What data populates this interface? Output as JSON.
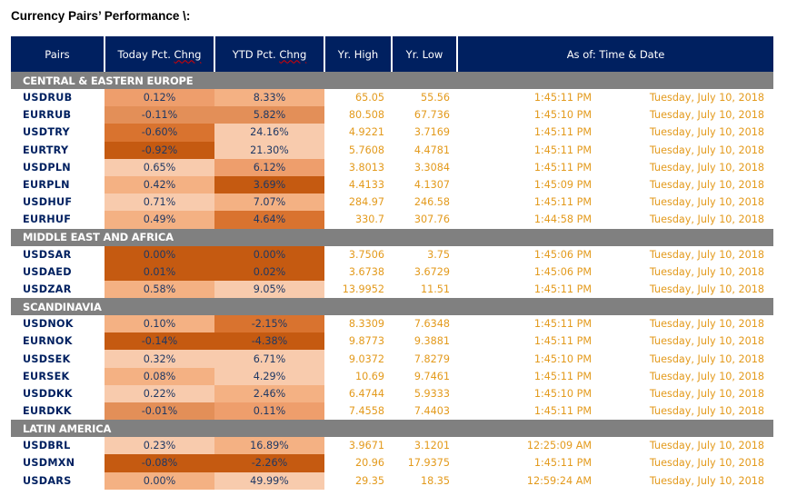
{
  "title": "Currency Pairs’ Performance \\:",
  "header": {
    "pairs": "Pairs",
    "today_pre": "Today Pct. ",
    "today_sq": "Chng",
    "ytd_pre": "YTD Pct. ",
    "ytd_sq": "Chng",
    "high": "Yr. High",
    "low": "Yr. Low",
    "asof": "As of: Time & Date"
  },
  "heat_colors": {
    "1": "#F8CBAD",
    "2": "#F4B183",
    "3": "#EE9E6C",
    "4": "#E38F58",
    "5": "#D9732F",
    "6": "#C55A11"
  },
  "groups": [
    {
      "name": "CENTRAL & EASTERN EUROPE",
      "rows": [
        {
          "pair": "USDRUB",
          "today": "0.12%",
          "today_heat": 3,
          "ytd": "8.33%",
          "ytd_heat": 2,
          "high": "65.05",
          "low": "55.56",
          "time": "1:45:11 PM",
          "date": "Tuesday, July 10, 2018"
        },
        {
          "pair": "EURRUB",
          "today": "-0.11%",
          "today_heat": 4,
          "ytd": "5.82%",
          "ytd_heat": 4,
          "high": "80.508",
          "low": "67.736",
          "time": "1:45:10 PM",
          "date": "Tuesday, July 10, 2018"
        },
        {
          "pair": "USDTRY",
          "today": "-0.60%",
          "today_heat": 5,
          "ytd": "24.16%",
          "ytd_heat": 1,
          "high": "4.9221",
          "low": "3.7169",
          "time": "1:45:11 PM",
          "date": "Tuesday, July 10, 2018"
        },
        {
          "pair": "EURTRY",
          "today": "-0.92%",
          "today_heat": 6,
          "ytd": "21.30%",
          "ytd_heat": 1,
          "high": "5.7608",
          "low": "4.4781",
          "time": "1:45:11 PM",
          "date": "Tuesday, July 10, 2018"
        },
        {
          "pair": "USDPLN",
          "today": "0.65%",
          "today_heat": 1,
          "ytd": "6.12%",
          "ytd_heat": 3,
          "high": "3.8013",
          "low": "3.3084",
          "time": "1:45:11 PM",
          "date": "Tuesday, July 10, 2018"
        },
        {
          "pair": "EURPLN",
          "today": "0.42%",
          "today_heat": 2,
          "ytd": "3.69%",
          "ytd_heat": 6,
          "high": "4.4133",
          "low": "4.1307",
          "time": "1:45:09 PM",
          "date": "Tuesday, July 10, 2018"
        },
        {
          "pair": "USDHUF",
          "today": "0.71%",
          "today_heat": 1,
          "ytd": "7.07%",
          "ytd_heat": 2,
          "high": "284.97",
          "low": "246.58",
          "time": "1:45:11 PM",
          "date": "Tuesday, July 10, 2018"
        },
        {
          "pair": "EURHUF",
          "today": "0.49%",
          "today_heat": 2,
          "ytd": "4.64%",
          "ytd_heat": 5,
          "high": "330.7",
          "low": "307.76",
          "time": "1:44:58 PM",
          "date": "Tuesday, July 10, 2018"
        }
      ]
    },
    {
      "name": "MIDDLE EAST AND AFRICA",
      "rows": [
        {
          "pair": "USDSAR",
          "today": "0.00%",
          "today_heat": 6,
          "ytd": "0.00%",
          "ytd_heat": 6,
          "high": "3.7506",
          "low": "3.75",
          "time": "1:45:06 PM",
          "date": "Tuesday, July 10, 2018"
        },
        {
          "pair": "USDAED",
          "today": "0.01%",
          "today_heat": 6,
          "ytd": "0.02%",
          "ytd_heat": 6,
          "high": "3.6738",
          "low": "3.6729",
          "time": "1:45:06 PM",
          "date": "Tuesday, July 10, 2018"
        },
        {
          "pair": "USDZAR",
          "today": "0.58%",
          "today_heat": 2,
          "ytd": "9.05%",
          "ytd_heat": 1,
          "high": "13.9952",
          "low": "11.51",
          "time": "1:45:11 PM",
          "date": "Tuesday, July 10, 2018"
        }
      ]
    },
    {
      "name": "SCANDINAVIA",
      "rows": [
        {
          "pair": "USDNOK",
          "today": "0.10%",
          "today_heat": 2,
          "ytd": "-2.15%",
          "ytd_heat": 5,
          "high": "8.3309",
          "low": "7.6348",
          "time": "1:45:11 PM",
          "date": "Tuesday, July 10, 2018"
        },
        {
          "pair": "EURNOK",
          "today": "-0.14%",
          "today_heat": 6,
          "ytd": "-4.38%",
          "ytd_heat": 6,
          "high": "9.8773",
          "low": "9.3881",
          "time": "1:45:11 PM",
          "date": "Tuesday, July 10, 2018"
        },
        {
          "pair": "USDSEK",
          "today": "0.32%",
          "today_heat": 1,
          "ytd": "6.71%",
          "ytd_heat": 1,
          "high": "9.0372",
          "low": "7.8279",
          "time": "1:45:10 PM",
          "date": "Tuesday, July 10, 2018"
        },
        {
          "pair": "EURSEK",
          "today": "0.08%",
          "today_heat": 2,
          "ytd": "4.29%",
          "ytd_heat": 1,
          "high": "10.69",
          "low": "9.7461",
          "time": "1:45:11 PM",
          "date": "Tuesday, July 10, 2018"
        },
        {
          "pair": "USDDKK",
          "today": "0.22%",
          "today_heat": 1,
          "ytd": "2.46%",
          "ytd_heat": 2,
          "high": "6.4744",
          "low": "5.9333",
          "time": "1:45:10 PM",
          "date": "Tuesday, July 10, 2018"
        },
        {
          "pair": "EURDKK",
          "today": "-0.01%",
          "today_heat": 4,
          "ytd": "0.11%",
          "ytd_heat": 3,
          "high": "7.4558",
          "low": "7.4403",
          "time": "1:45:11 PM",
          "date": "Tuesday, July 10, 2018"
        }
      ]
    },
    {
      "name": "LATIN AMERICA",
      "rows": [
        {
          "pair": "USDBRL",
          "today": "0.23%",
          "today_heat": 1,
          "ytd": "16.89%",
          "ytd_heat": 2,
          "high": "3.9671",
          "low": "3.1201",
          "time": "12:25:09 AM",
          "date": "Tuesday, July 10, 2018"
        },
        {
          "pair": "USDMXN",
          "today": "-0.08%",
          "today_heat": 6,
          "ytd": "-2.26%",
          "ytd_heat": 6,
          "high": "20.96",
          "low": "17.9375",
          "time": "1:45:11 PM",
          "date": "Tuesday, July 10, 2018"
        },
        {
          "pair": "USDARS",
          "today": "0.00%",
          "today_heat": 2,
          "ytd": "49.99%",
          "ytd_heat": 1,
          "high": "29.35",
          "low": "18.35",
          "time": "12:59:24 AM",
          "date": "Tuesday, July 10, 2018"
        }
      ]
    }
  ]
}
